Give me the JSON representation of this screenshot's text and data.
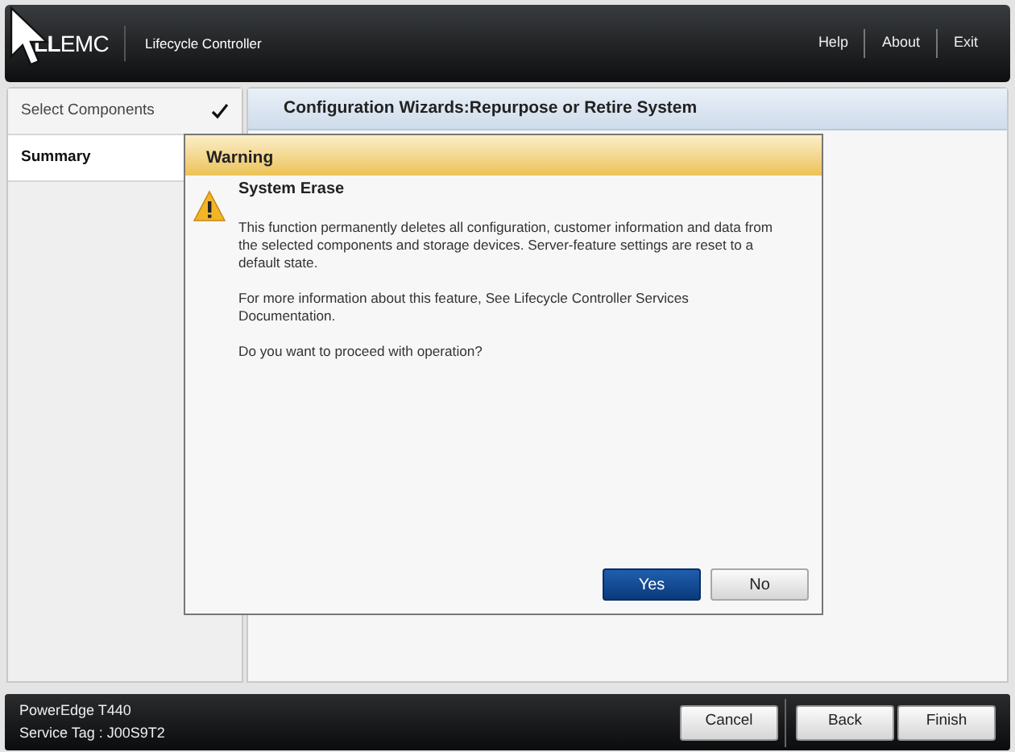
{
  "header": {
    "logo": "**LL**EMC",
    "product": "Lifecycle Controller",
    "links": [
      "Help",
      "About",
      "Exit"
    ]
  },
  "steps": [
    {
      "label": "Select Components",
      "selected": false,
      "completed": true
    },
    {
      "label": "Summary",
      "selected": true,
      "completed": false
    }
  ],
  "page_title": "Configuration Wizards:Repurpose or Retire System",
  "dialog": {
    "title": "Warning",
    "heading": "System Erase",
    "paragraphs": [
      "This function permanently deletes all configuration, customer information and data from the selected components and storage devices. Server-feature settings are reset to a default state.",
      "For more information about this feature, See Lifecycle Controller Services Documentation.",
      "Do you want to proceed with operation?"
    ],
    "buttons": [
      {
        "label": "Yes",
        "primary": true
      },
      {
        "label": "No",
        "primary": false
      }
    ]
  },
  "footer": {
    "model": "PowerEdge T440",
    "service_tag": "Service Tag : J00S9T2",
    "buttons": [
      "Cancel",
      "Back",
      "Finish"
    ]
  }
}
